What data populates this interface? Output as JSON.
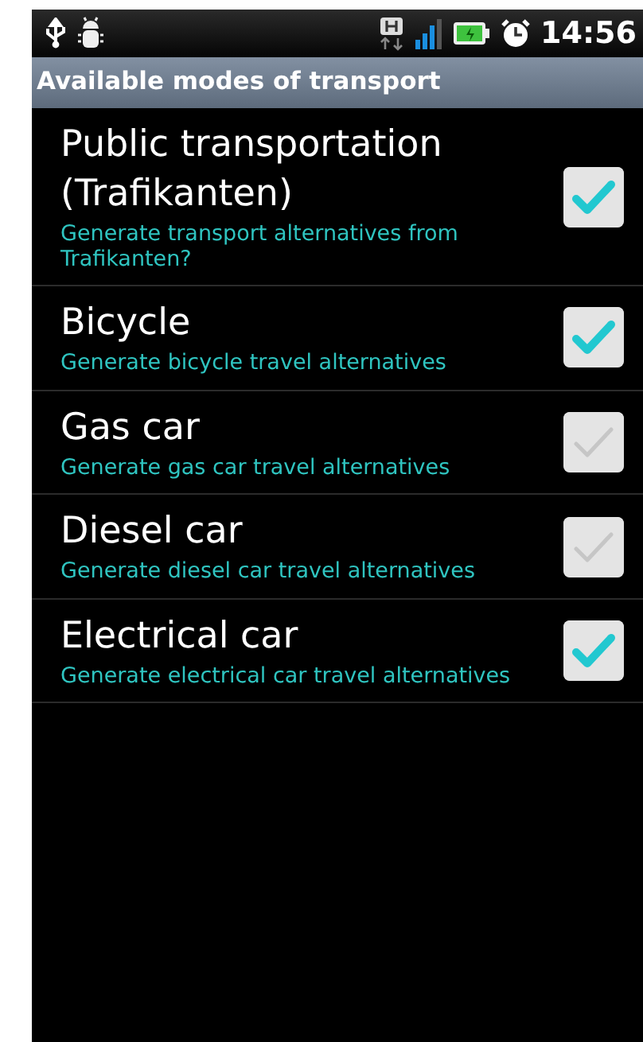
{
  "status_bar": {
    "time": "14:56"
  },
  "title_bar": {
    "title": "Available modes of transport"
  },
  "options": [
    {
      "title": "Public transportation (Trafikanten)",
      "summary": "Generate transport alternatives from Trafikanten?",
      "checked": true
    },
    {
      "title": "Bicycle",
      "summary": "Generate bicycle travel alternatives",
      "checked": true
    },
    {
      "title": "Gas car",
      "summary": "Generate gas car travel alternatives",
      "checked": false
    },
    {
      "title": "Diesel car",
      "summary": "Generate diesel car travel alternatives",
      "checked": false
    },
    {
      "title": "Electrical car",
      "summary": "Generate electrical car travel alternatives",
      "checked": true
    }
  ]
}
